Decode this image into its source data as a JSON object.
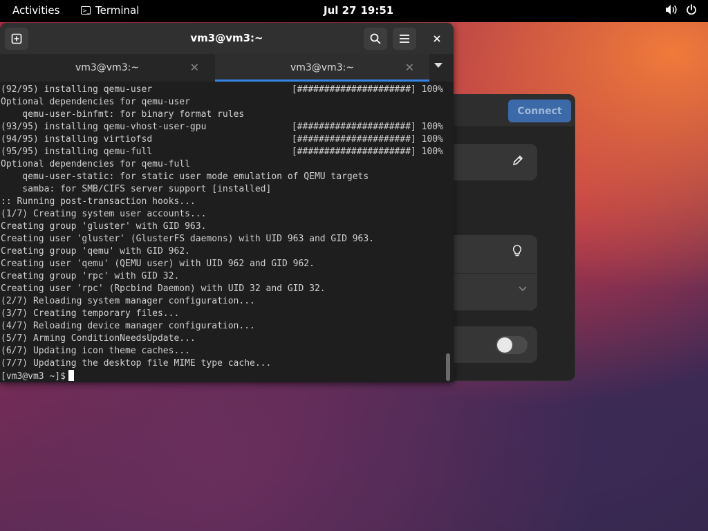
{
  "topbar": {
    "activities": "Activities",
    "app_name": "Terminal",
    "date": "Jul 27",
    "time": "19:51"
  },
  "terminal": {
    "title": "vm3@vm3:~",
    "tabs": [
      {
        "label": "vm3@vm3:~",
        "active": false
      },
      {
        "label": "vm3@vm3:~",
        "active": true
      }
    ],
    "lines": [
      {
        "text": "(92/95) installing qemu-user",
        "right": "[#####################] 100%"
      },
      {
        "text": "Optional dependencies for qemu-user",
        "right": ""
      },
      {
        "text": "    qemu-user-binfmt: for binary format rules",
        "right": ""
      },
      {
        "text": "(93/95) installing qemu-vhost-user-gpu",
        "right": "[#####################] 100%"
      },
      {
        "text": "(94/95) installing virtiofsd",
        "right": "[#####################] 100%"
      },
      {
        "text": "(95/95) installing qemu-full",
        "right": "[#####################] 100%"
      },
      {
        "text": "Optional dependencies for qemu-full",
        "right": ""
      },
      {
        "text": "    qemu-user-static: for static user mode emulation of QEMU targets",
        "right": ""
      },
      {
        "text": "    samba: for SMB/CIFS server support [installed]",
        "right": ""
      },
      {
        "text": ":: Running post-transaction hooks...",
        "right": ""
      },
      {
        "text": "(1/7) Creating system user accounts...",
        "right": ""
      },
      {
        "text": "Creating group 'gluster' with GID 963.",
        "right": ""
      },
      {
        "text": "Creating user 'gluster' (GlusterFS daemons) with UID 963 and GID 963.",
        "right": ""
      },
      {
        "text": "Creating group 'qemu' with GID 962.",
        "right": ""
      },
      {
        "text": "Creating user 'qemu' (QEMU user) with UID 962 and GID 962.",
        "right": ""
      },
      {
        "text": "Creating group 'rpc' with GID 32.",
        "right": ""
      },
      {
        "text": "Creating user 'rpc' (Rpcbind Daemon) with UID 32 and GID 32.",
        "right": ""
      },
      {
        "text": "(2/7) Reloading system manager configuration...",
        "right": ""
      },
      {
        "text": "(3/7) Creating temporary files...",
        "right": ""
      },
      {
        "text": "(4/7) Reloading device manager configuration...",
        "right": ""
      },
      {
        "text": "(5/7) Arming ConditionNeedsUpdate...",
        "right": ""
      },
      {
        "text": "(6/7) Updating icon theme caches...",
        "right": ""
      },
      {
        "text": "(7/7) Updating the desktop file MIME type cache...",
        "right": ""
      }
    ],
    "prompt": "[vm3@vm3 ~]$"
  },
  "background_window": {
    "connect_label": "Connect",
    "toggle_on": false
  }
}
